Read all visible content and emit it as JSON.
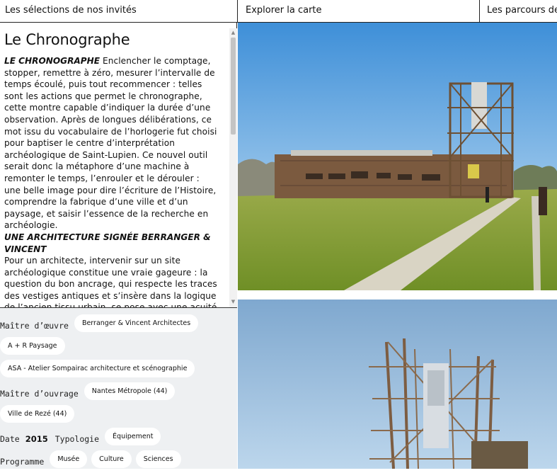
{
  "nav": {
    "tabs": [
      {
        "label": "Les sélections de nos invités"
      },
      {
        "label": "Explorer la carte"
      },
      {
        "label": "Les parcours de"
      }
    ]
  },
  "article": {
    "title": "Le Chronographe",
    "section1_heading": "LE CHRONOGRAPHE",
    "section1_text": " Enclencher le comptage, stopper, remettre à zéro, mesurer l’intervalle de temps écoulé, puis tout recommencer : telles sont les actions que permet le chronographe, cette montre capable d’indiquer la durée d’une observation. Après de longues délibérations, ce mot issu du vocabulaire de l’horlogerie fut choisi pour baptiser le centre d’interprétation archéologique de Saint-Lupien. Ce nouvel outil serait donc la métaphore d’une machine à remonter le temps, l’enrouler et le dérouler : une belle image pour dire l’écriture de l’Histoire, comprendre la fabrique d’une ville et d’un paysage, et saisir l’essence de la recherche en archéologie.",
    "section2_heading": "UNE ARCHITECTURE SIGNÉE BERRANGER & VINCENT",
    "section2_text": "Pour un architecte, intervenir sur un site archéologique constitue une vraie gageure : la question du bon ancrage, qui respecte les traces des vestiges antiques et s’insère dans la logique de l’ancien tissu urbain, se pose avec une acuité particulière, tant vis-à-vis du paysage que par la nature même du programme, car le bâtiment conçu par Jérôme Berranger et Stéphanie Vincent a pour"
  },
  "meta": {
    "maitre_oeuvre_label": "Maître d’œuvre",
    "maitre_oeuvre": [
      "Berranger & Vincent Architectes",
      "A + R Paysage",
      "ASA - Atelier Sompairac architecture et scénographie"
    ],
    "maitre_ouvrage_label": "Maître d’ouvrage",
    "maitre_ouvrage": [
      "Nantes Métropole (44)",
      "Ville de Rezé (44)"
    ],
    "date_label": "Date",
    "date_value": "2015",
    "typologie_label": "Typologie",
    "typologie": "Équipement",
    "programme_label": "Programme",
    "programme": [
      "Musée",
      "Culture",
      "Sciences"
    ]
  },
  "images": {
    "photo1": "chronographe-building-photo",
    "photo2": "chronographe-tower-photo"
  }
}
